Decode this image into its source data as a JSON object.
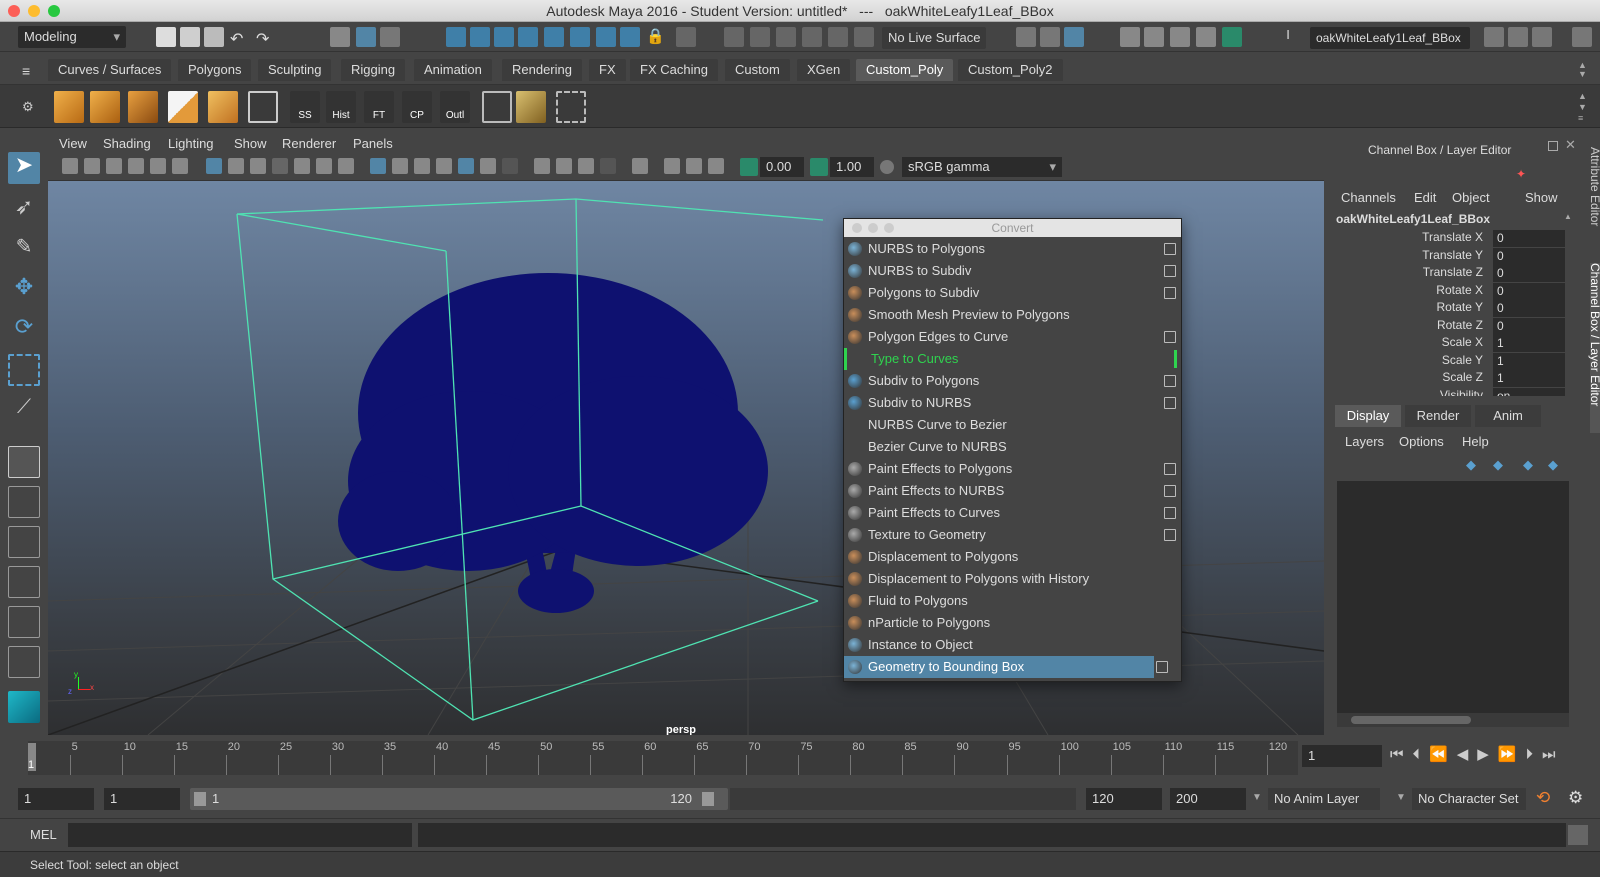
{
  "window": {
    "title": "Autodesk Maya 2016 - Student Version: untitled*   ---   oakWhiteLeafy1Leaf_BBox"
  },
  "statusline": {
    "menuset": "Modeling",
    "live_surface": "No Live Surface",
    "object_field": "oakWhiteLeafy1Leaf_BBox"
  },
  "shelf": {
    "tabs": [
      "Curves / Surfaces",
      "Polygons",
      "Sculpting",
      "Rigging",
      "Animation",
      "Rendering",
      "FX",
      "FX Caching",
      "Custom",
      "XGen",
      "Custom_Poly",
      "Custom_Poly2"
    ],
    "active_tab": "Custom_Poly",
    "icon_labels": [
      "SS",
      "Hist",
      "FT",
      "CP",
      "Outl"
    ]
  },
  "viewport": {
    "menus": [
      "View",
      "Shading",
      "Lighting",
      "Show",
      "Renderer",
      "Panels"
    ],
    "exposure": "0.00",
    "gamma": "1.00",
    "color_space": "sRGB gamma",
    "camera": "persp",
    "axis_x": "x",
    "axis_y": "y",
    "axis_z": "z"
  },
  "convert": {
    "title": "Convert",
    "items": [
      {
        "label": "NURBS to Polygons",
        "box": true
      },
      {
        "label": "NURBS to Subdiv",
        "box": true
      },
      {
        "label": "Polygons to Subdiv",
        "box": true
      },
      {
        "label": "Smooth Mesh Preview to Polygons",
        "box": false
      },
      {
        "label": "Polygon Edges to Curve",
        "box": true
      },
      {
        "label": "Type to Curves",
        "box": false
      },
      {
        "label": "Subdiv to Polygons",
        "box": true
      },
      {
        "label": "Subdiv to NURBS",
        "box": true
      },
      {
        "label": "NURBS Curve to Bezier",
        "box": false
      },
      {
        "label": "Bezier Curve to NURBS",
        "box": false
      },
      {
        "label": "Paint Effects to Polygons",
        "box": true
      },
      {
        "label": "Paint Effects to NURBS",
        "box": true
      },
      {
        "label": "Paint Effects to Curves",
        "box": true
      },
      {
        "label": "Texture to Geometry",
        "box": true
      },
      {
        "label": "Displacement to Polygons",
        "box": false
      },
      {
        "label": "Displacement to Polygons with History",
        "box": false
      },
      {
        "label": "Fluid to Polygons",
        "box": false
      },
      {
        "label": "nParticle to Polygons",
        "box": false
      },
      {
        "label": "Instance to Object",
        "box": false
      },
      {
        "label": "Geometry to Bounding Box",
        "box": true
      }
    ],
    "highlighted_index": 19
  },
  "channel_box": {
    "title": "Channel Box / Layer Editor",
    "menus": [
      "Channels",
      "Edit",
      "Object",
      "Show"
    ],
    "object": "oakWhiteLeafy1Leaf_BBox",
    "channels": [
      {
        "name": "Translate X",
        "value": "0"
      },
      {
        "name": "Translate Y",
        "value": "0"
      },
      {
        "name": "Translate Z",
        "value": "0"
      },
      {
        "name": "Rotate X",
        "value": "0"
      },
      {
        "name": "Rotate Y",
        "value": "0"
      },
      {
        "name": "Rotate Z",
        "value": "0"
      },
      {
        "name": "Scale X",
        "value": "1"
      },
      {
        "name": "Scale Y",
        "value": "1"
      },
      {
        "name": "Scale Z",
        "value": "1"
      },
      {
        "name": "Visibility",
        "value": "on"
      }
    ],
    "layer_tabs": [
      "Display",
      "Render",
      "Anim"
    ],
    "layer_menus": [
      "Layers",
      "Options",
      "Help"
    ]
  },
  "side_tabs": {
    "attribute": "Attribute Editor",
    "channel": "Channel Box / Layer Editor"
  },
  "time": {
    "ticks": [
      "5",
      "10",
      "15",
      "20",
      "25",
      "30",
      "35",
      "40",
      "45",
      "50",
      "55",
      "60",
      "65",
      "70",
      "75",
      "80",
      "85",
      "90",
      "95",
      "100",
      "105",
      "110",
      "115",
      "120"
    ],
    "current": "1",
    "current_marker": "1"
  },
  "range": {
    "start": "1",
    "playback_start": "1",
    "slider_start": "1",
    "slider_end": "120",
    "playback_end": "120",
    "end": "200",
    "anim_layer": "No Anim Layer",
    "char_set": "No Character Set"
  },
  "cmd": {
    "label": "MEL"
  },
  "help": {
    "text": "Select Tool: select an object"
  }
}
